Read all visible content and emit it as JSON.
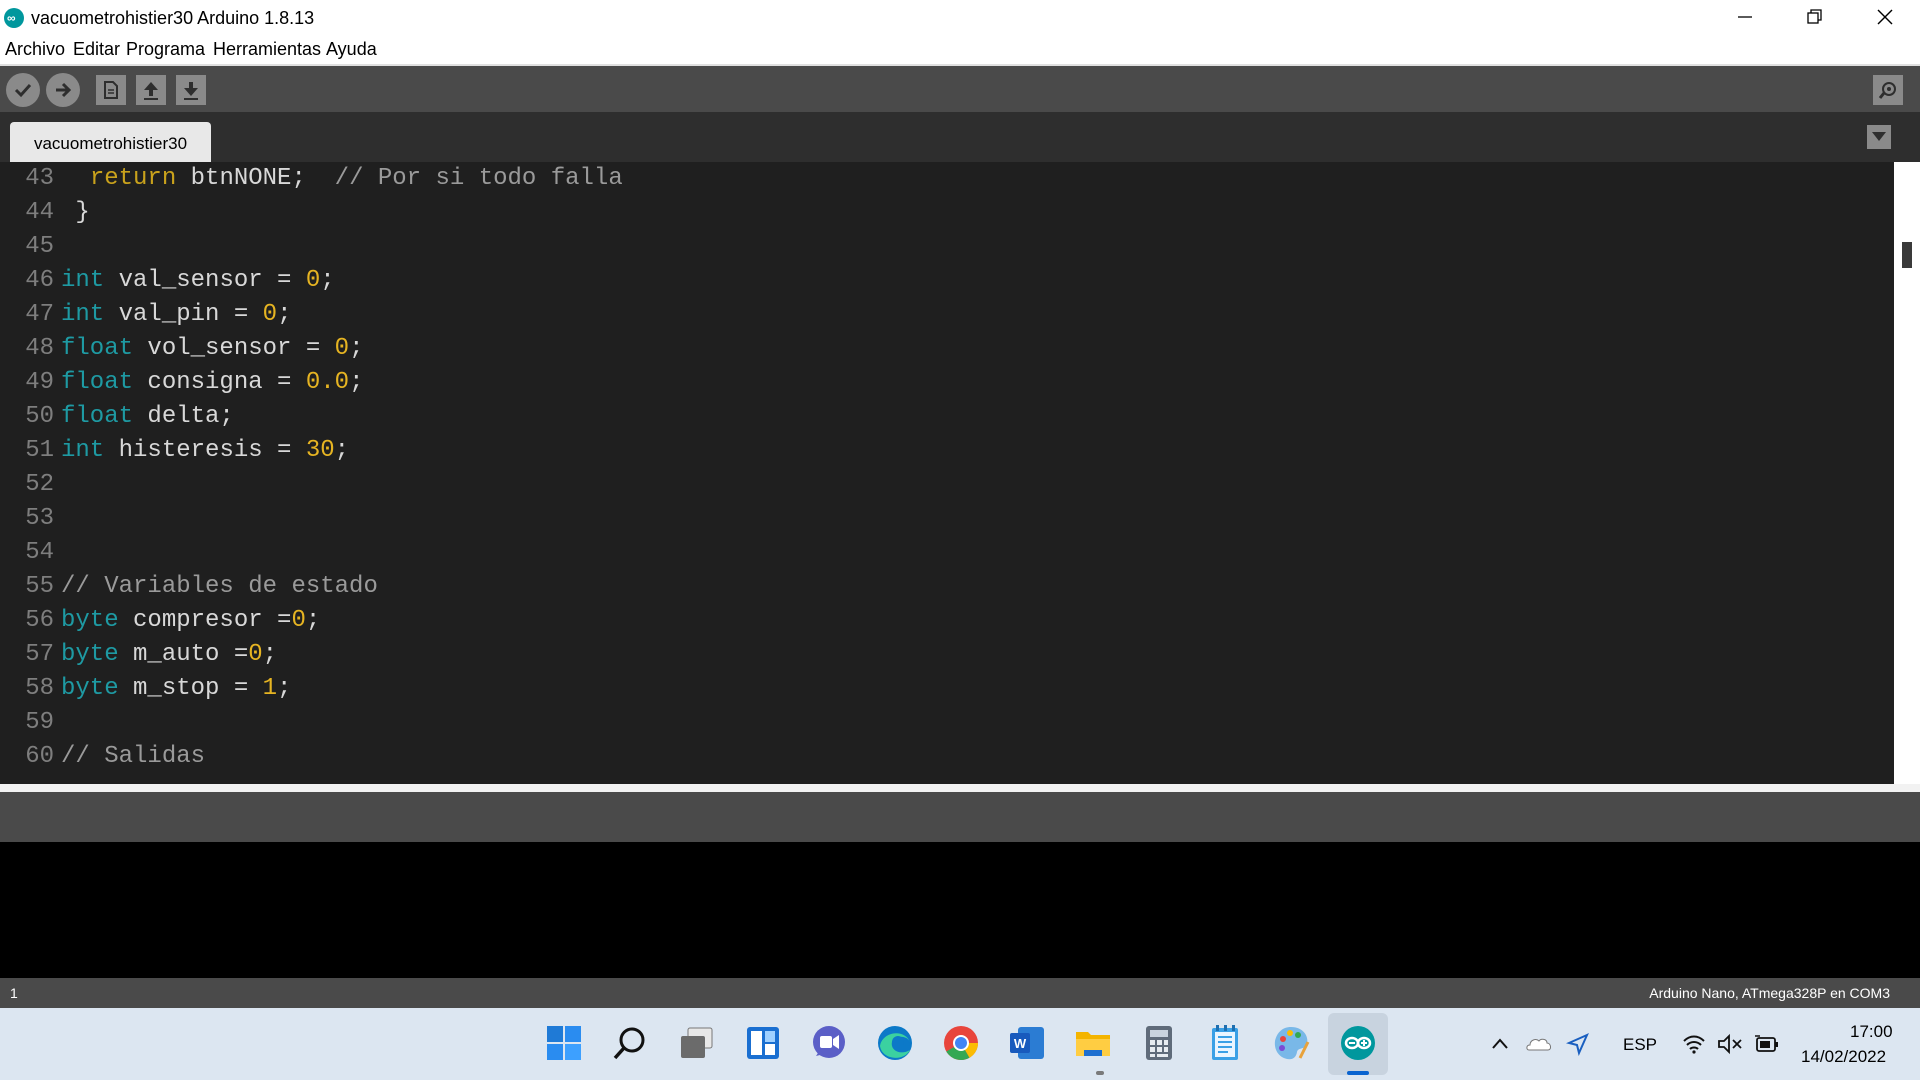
{
  "window": {
    "title": "vacuometrohistier30 Arduino 1.8.13",
    "logo_icon": "arduino-logo-icon",
    "controls": [
      "minimize-icon",
      "restore-icon",
      "close-icon"
    ]
  },
  "menu": [
    "Archivo",
    "Editar",
    "Programa",
    "Herramientas",
    "Ayuda"
  ],
  "toolbar": {
    "buttons": [
      "verify-icon",
      "upload-icon",
      "new-icon",
      "open-icon",
      "save-icon"
    ],
    "serial_monitor_icon": "serial-monitor-icon"
  },
  "tabs": [
    {
      "label": "vacuometrohistier30",
      "active": true
    }
  ],
  "editor": {
    "lines": [
      {
        "num": "43",
        "code": "  return btnNONE;  // Por si todo falla"
      },
      {
        "num": "44",
        "code": " }"
      },
      {
        "num": "45",
        "code": ""
      },
      {
        "num": "46",
        "code": "int val_sensor = 0;"
      },
      {
        "num": "47",
        "code": "int val_pin = 0;"
      },
      {
        "num": "48",
        "code": "float vol_sensor = 0;"
      },
      {
        "num": "49",
        "code": "float consigna = 0.0;"
      },
      {
        "num": "50",
        "code": "float delta;"
      },
      {
        "num": "51",
        "code": "int histeresis = 30;"
      },
      {
        "num": "52",
        "code": ""
      },
      {
        "num": "53",
        "code": ""
      },
      {
        "num": "54",
        "code": ""
      },
      {
        "num": "55",
        "code": "// Variables de estado"
      },
      {
        "num": "56",
        "code": "byte compresor =0;"
      },
      {
        "num": "57",
        "code": "byte m_auto =0;"
      },
      {
        "num": "58",
        "code": "byte m_stop = 1;"
      },
      {
        "num": "59",
        "code": ""
      },
      {
        "num": "60",
        "code": "// Salidas"
      }
    ]
  },
  "status": {
    "line": "1",
    "board": "Arduino Nano, ATmega328P en COM3"
  },
  "taskbar": {
    "apps": [
      "start-icon",
      "search-icon",
      "task-view-icon",
      "widgets-icon",
      "teams-chat-icon",
      "edge-icon",
      "chrome-icon",
      "word-icon",
      "file-explorer-icon",
      "calculator-icon",
      "notepad-icon",
      "paint-icon",
      "arduino-icon"
    ],
    "tray": {
      "language": "ESP",
      "time": "17:00",
      "date": "14/02/2022",
      "icons": [
        "chevron-up-icon",
        "onedrive-icon",
        "location-icon",
        "wifi-icon",
        "mute-icon",
        "battery-icon"
      ]
    }
  },
  "colors": {
    "editor_bg": "#1f1f1f",
    "keyword": "#1e9aa3",
    "return_keyword": "#c9a21c",
    "number": "#e6b422",
    "comment": "#9a9a9a",
    "toolbar_bg": "#4a4a4a",
    "arduino_teal": "#00979d"
  }
}
